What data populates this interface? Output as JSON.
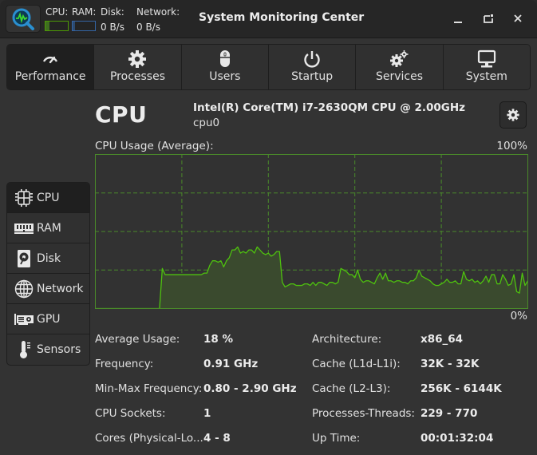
{
  "header": {
    "title": "System Monitoring Center",
    "cpu_label": "CPU:",
    "ram_label": "RAM:",
    "disk_label": "Disk:",
    "network_label": "Network:",
    "disk_value": "0 B/s",
    "network_value": "0 B/s",
    "cpu_bar_fraction": 0.18,
    "ram_bar_fraction": 0.1,
    "cpu_color": "#4e9a06",
    "ram_color": "#3465a4",
    "app_icon": "monitor-search-icon",
    "controls": [
      {
        "name": "minimize",
        "icon": "minimize-icon"
      },
      {
        "name": "restore",
        "icon": "restore-icon"
      },
      {
        "name": "close",
        "icon": "close-icon"
      }
    ]
  },
  "tabs": [
    {
      "label": "Performance",
      "icon": "gauge-icon",
      "active": true
    },
    {
      "label": "Processes",
      "icon": "gear-icon",
      "active": false
    },
    {
      "label": "Users",
      "icon": "mouse-icon",
      "active": false
    },
    {
      "label": "Startup",
      "icon": "power-icon",
      "active": false
    },
    {
      "label": "Services",
      "icon": "gears-icon",
      "active": false
    },
    {
      "label": "System",
      "icon": "monitor-icon",
      "active": false
    }
  ],
  "sidebar": {
    "items": [
      {
        "label": "CPU",
        "icon": "cpu-chip-icon",
        "active": true
      },
      {
        "label": "RAM",
        "icon": "ram-module-icon",
        "active": false
      },
      {
        "label": "Disk",
        "icon": "hard-disk-icon",
        "active": false
      },
      {
        "label": "Network",
        "icon": "globe-icon",
        "active": false
      },
      {
        "label": "GPU",
        "icon": "graphics-card-icon",
        "active": false
      },
      {
        "label": "Sensors",
        "icon": "thermometer-icon",
        "active": false
      }
    ]
  },
  "main": {
    "title": "CPU",
    "cpu_model": "Intel(R) Core(TM) i7-2630QM CPU @ 2.00GHz",
    "cpu_name": "cpu0",
    "settings_icon": "gear-icon",
    "graph_label": "CPU Usage (Average):",
    "graph_max_label": "100%",
    "graph_min_label": "0%",
    "details_left": [
      {
        "label": "Average Usage:",
        "value": "18 %"
      },
      {
        "label": "Frequency:",
        "value": "0.91 GHz"
      },
      {
        "label": "Min-Max Frequency:",
        "value": "0.80 - 2.90 GHz"
      },
      {
        "label": "CPU Sockets:",
        "value": "1"
      },
      {
        "label": "Cores (Physical-Lo...",
        "value": "4 - 8"
      }
    ],
    "details_right": [
      {
        "label": "Architecture:",
        "value": "x86_64"
      },
      {
        "label": "Cache (L1d-L1i):",
        "value": "32K - 32K"
      },
      {
        "label": "Cache (L2-L3):",
        "value": "256K - 6144K"
      },
      {
        "label": "Processes-Threads:",
        "value": "229 - 770"
      },
      {
        "label": "Up Time:",
        "value": "00:01:32:04"
      }
    ]
  },
  "chart_data": {
    "type": "area",
    "title": "CPU Usage (Average):",
    "ylabel": "",
    "xlabel": "",
    "ylim": [
      0,
      100
    ],
    "y_max_label": "100%",
    "y_min_label": "0%",
    "grid": true,
    "grid_divisions": {
      "x": 5,
      "y": 4
    },
    "line_color": "#4ec20e",
    "fill_color": "#3a4a2e",
    "grid_color": "#4a8a2a",
    "series": [
      {
        "name": "CPU Usage",
        "values": [
          0,
          0,
          0,
          0,
          0,
          0,
          0,
          0,
          0,
          0,
          0,
          0,
          0,
          0,
          0,
          0,
          0,
          0,
          0,
          0,
          0,
          0,
          0,
          0,
          26,
          22,
          22,
          22,
          22,
          22,
          22,
          22,
          22,
          22,
          22,
          22,
          22,
          22,
          22,
          23,
          23,
          28,
          31,
          31,
          30,
          31,
          27,
          31,
          33,
          38,
          38,
          40,
          36,
          37,
          36,
          38,
          38,
          36,
          40,
          38,
          36,
          35,
          36,
          34,
          35,
          37,
          37,
          17,
          14,
          15,
          16,
          16,
          15,
          15,
          15,
          16,
          16,
          15,
          17,
          15,
          17,
          17,
          16,
          15,
          17,
          17,
          16,
          17,
          26,
          25,
          24,
          22,
          22,
          20,
          25,
          19,
          17,
          18,
          18,
          17,
          16,
          20,
          23,
          19,
          23,
          18,
          18,
          17,
          18,
          18,
          17,
          17,
          16,
          18,
          18,
          20,
          25,
          21,
          20,
          19,
          18,
          16,
          15,
          15,
          16,
          17,
          19,
          17,
          17,
          18,
          16,
          16,
          24,
          19,
          18,
          19,
          17,
          18,
          16,
          18,
          21,
          17,
          22,
          22,
          16,
          16,
          22,
          19,
          15,
          16,
          22,
          11,
          10,
          23,
          15,
          18
        ]
      }
    ]
  }
}
